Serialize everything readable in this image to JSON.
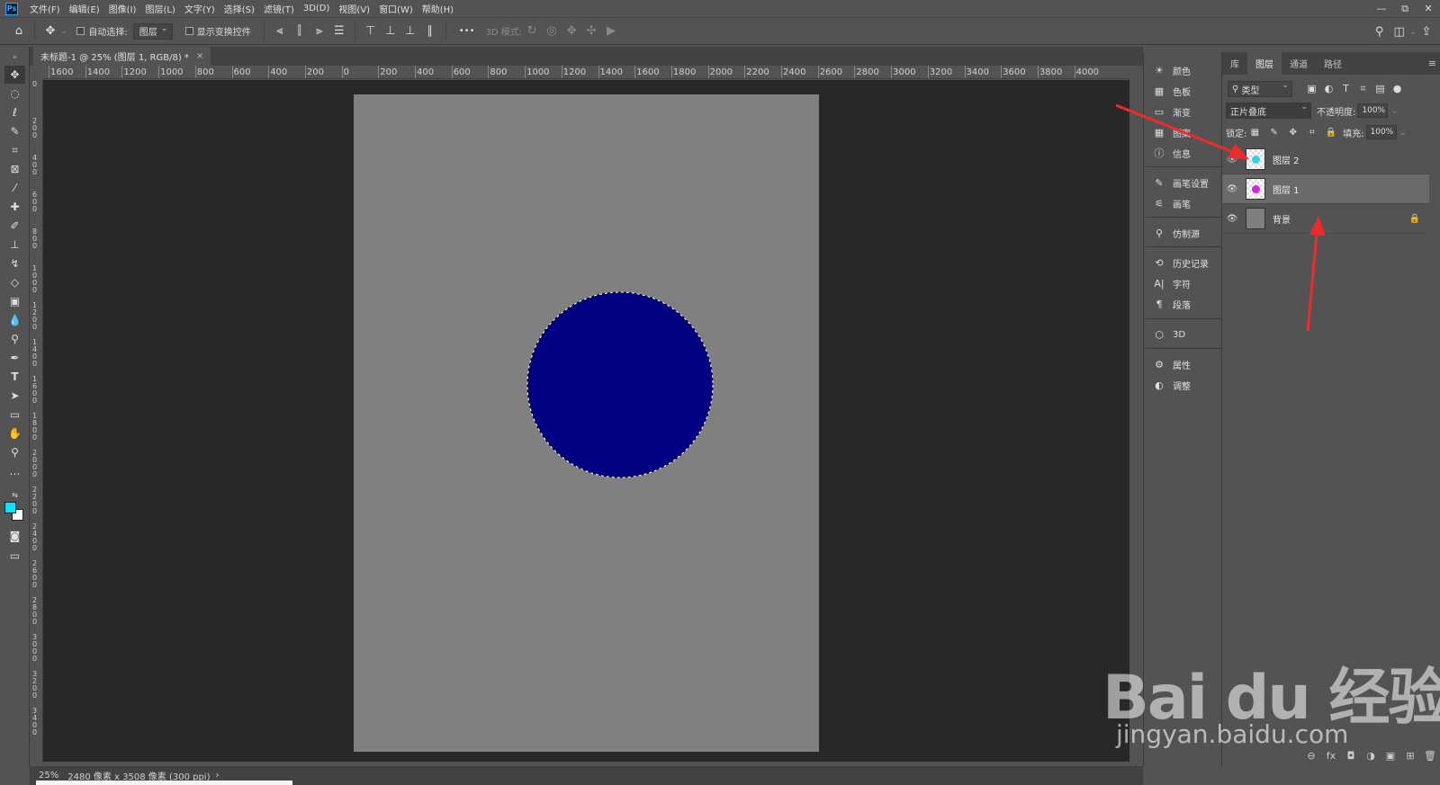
{
  "app": {
    "logo": "Ps"
  },
  "menu": [
    "文件(F)",
    "编辑(E)",
    "图像(I)",
    "图层(L)",
    "文字(Y)",
    "选择(S)",
    "滤镜(T)",
    "3D(D)",
    "视图(V)",
    "窗口(W)",
    "帮助(H)"
  ],
  "window_controls": {
    "minimize": "—",
    "restore": "⧉",
    "close": "✕"
  },
  "options": {
    "auto_select_label": "自动选择:",
    "auto_select_value": "图层",
    "show_transform_label": "显示变换控件",
    "more": "•••",
    "mode_3d_label": "3D 模式:"
  },
  "document": {
    "tab_title": "未标题-1 @ 25% (图层 1, RGB/8) *",
    "close": "×",
    "zoom": "25%",
    "info": "2480 像素 x 3508 像素 (300 ppi)",
    "info_arrow": "›"
  },
  "ruler": {
    "h_labels": [
      "1600",
      "1400",
      "1200",
      "1000",
      "800",
      "600",
      "400",
      "200",
      "0",
      "200",
      "400",
      "600",
      "800",
      "1000",
      "1200",
      "1400",
      "1600",
      "1800",
      "2000",
      "2200",
      "2400",
      "2600",
      "2800",
      "3000",
      "3200",
      "3400",
      "3600",
      "3800",
      "4000"
    ],
    "v_labels": [
      "0",
      "2\n0\n0",
      "4\n0\n0",
      "6\n0\n0",
      "8\n0\n0",
      "1\n0\n0\n0",
      "1\n2\n0\n0",
      "1\n4\n0\n0",
      "1\n6\n0\n0",
      "1\n8\n0\n0",
      "2\n0\n0\n0",
      "2\n2\n0\n0",
      "2\n4\n0\n0",
      "2\n6\n0\n0",
      "2\n8\n0\n0",
      "3\n0\n0\n0",
      "3\n2\n0\n0",
      "3\n4\n0\n0"
    ]
  },
  "colors": {
    "foreground": "#00e5ff",
    "background": "#ffffff",
    "circle": "#000080",
    "artboard": "#808080",
    "arrow": "#ee2b2b"
  },
  "dock": [
    {
      "icon": "☀",
      "label": "颜色"
    },
    {
      "icon": "▦",
      "label": "色板"
    },
    {
      "icon": "▭",
      "label": "渐变"
    },
    {
      "icon": "▦",
      "label": "图案"
    },
    {
      "icon": "ⓘ",
      "label": "信息"
    },
    {
      "icon": "✎",
      "label": "画笔设置"
    },
    {
      "icon": "⚟",
      "label": "画笔"
    },
    {
      "icon": "⚲",
      "label": "仿制源"
    },
    {
      "icon": "⟲",
      "label": "历史记录"
    },
    {
      "icon": "A|",
      "label": "字符"
    },
    {
      "icon": "¶",
      "label": "段落"
    },
    {
      "icon": "⬡",
      "label": "3D"
    },
    {
      "icon": "⚙",
      "label": "属性"
    },
    {
      "icon": "◐",
      "label": "调整"
    }
  ],
  "layers_panel": {
    "tabs": [
      "库",
      "图层",
      "通道",
      "路径"
    ],
    "active_tab": "图层",
    "menu": "≡",
    "filter": "类型",
    "blend_mode": "正片叠底",
    "opacity_label": "不透明度:",
    "opacity": "100%",
    "lock_label": "锁定:",
    "fill_label": "填充:",
    "fill": "100%",
    "layers": [
      {
        "name": "图层 2",
        "dot": "#2fd2ee",
        "selected": false,
        "locked": false
      },
      {
        "name": "图层 1",
        "dot": "#e020d8",
        "selected": true,
        "locked": false
      },
      {
        "name": "背景",
        "dot": "",
        "selected": false,
        "locked": true
      }
    ],
    "footer_icons": [
      "⊖",
      "fx",
      "◘",
      "◑",
      "▣",
      "⊞",
      "🗑"
    ]
  },
  "watermark": {
    "brand": "Bai du 经验",
    "url": "jingyan.baidu.com"
  }
}
